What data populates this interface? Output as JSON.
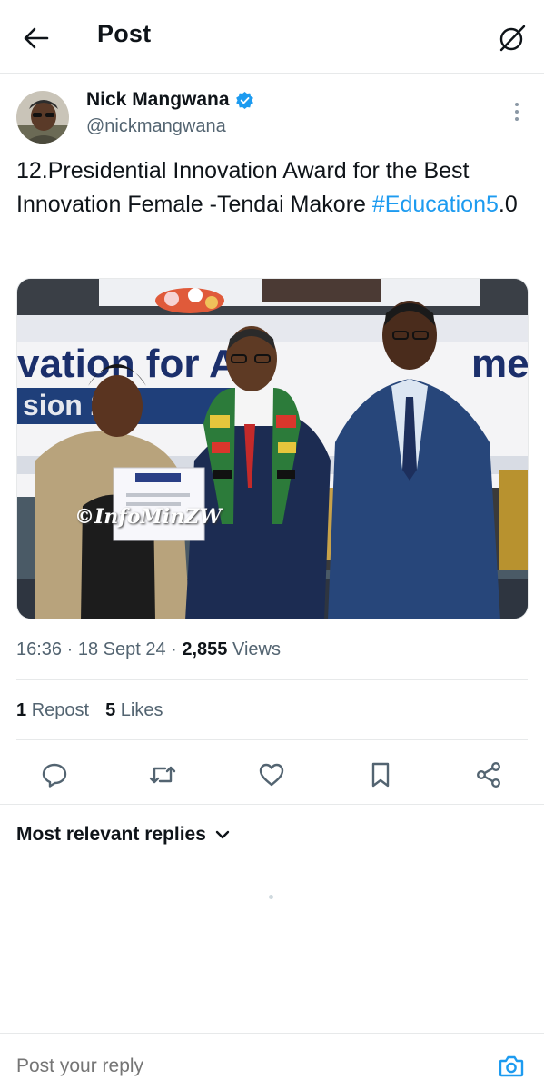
{
  "header": {
    "title": "Post",
    "back_icon": "arrow-left-icon",
    "grok_icon": "grok-icon"
  },
  "post": {
    "author_name": "Nick Mangwana",
    "author_handle": "@nickmangwana",
    "verified": true,
    "text_main": "12.Presidential Innovation Award for the Best Innovation Female -Tendai Makore ",
    "hashtag": "#Education5",
    "text_tail": ".0",
    "image_watermark": "©InfoMinZW",
    "time": "16:36",
    "date": "18 Sept 24",
    "views_count": "2,855",
    "views_label": "Views"
  },
  "stats": {
    "reposts_count": "1",
    "reposts_label": "Repost",
    "likes_count": "5",
    "likes_label": "Likes"
  },
  "actions": [
    "reply-icon",
    "repost-icon",
    "like-icon",
    "bookmark-icon",
    "share-icon"
  ],
  "replies": {
    "sort_label": "Most relevant replies"
  },
  "reply_bar": {
    "placeholder": "Post your reply"
  },
  "colors": {
    "accent": "#1d9bf0",
    "text": "#0f1419",
    "secondary": "#536471",
    "divider": "#e7e9ea"
  }
}
